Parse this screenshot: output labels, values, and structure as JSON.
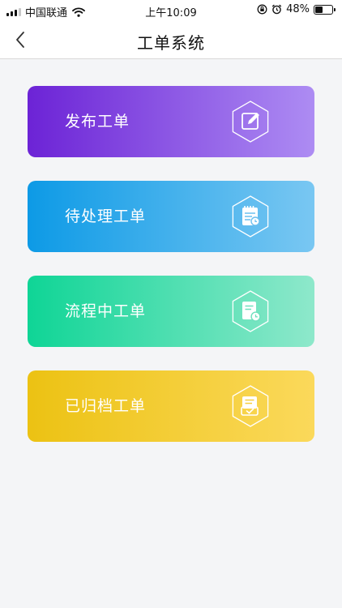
{
  "status_bar": {
    "carrier": "中国联通",
    "time": "上午10:09",
    "battery_percent_text": "48%",
    "battery_level": 0.48
  },
  "nav": {
    "title": "工单系统",
    "back_icon": "chevron-left-icon"
  },
  "cards": [
    {
      "label": "发布工单",
      "icon": "edit-icon",
      "color_start": "#6c23d6",
      "color_end": "#ad8cf3"
    },
    {
      "label": "待处理工单",
      "icon": "pending-list-icon",
      "color_start": "#0d9ae6",
      "color_end": "#79c7f2"
    },
    {
      "label": "流程中工单",
      "icon": "in-progress-doc-icon",
      "color_start": "#0fd596",
      "color_end": "#8ee8cb"
    },
    {
      "label": "已归档工单",
      "icon": "archived-doc-icon",
      "color_start": "#ecc213",
      "color_end": "#fbd95b"
    }
  ]
}
